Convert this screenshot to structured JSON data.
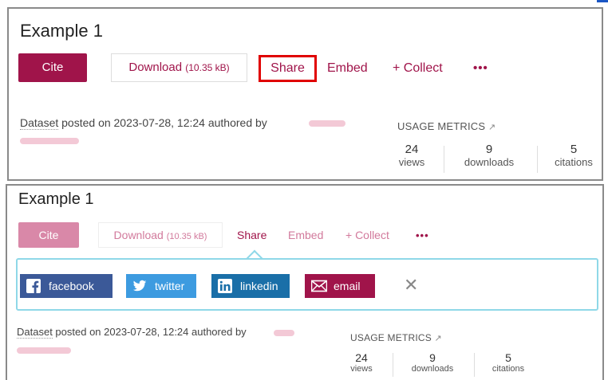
{
  "example1": {
    "title": "Example 1",
    "cite_label": "Cite",
    "download_label": "Download",
    "download_size": "(10.35 kB)",
    "share_label": "Share",
    "embed_label": "Embed",
    "collect_label": "+ Collect",
    "more_label": "•••",
    "posted_prefix": "Dataset",
    "posted_text": " posted on 2023-07-28, 12:24 authored by",
    "usage_label": "USAGE METRICS",
    "metrics": [
      {
        "value": "24",
        "label": "views"
      },
      {
        "value": "9",
        "label": "downloads"
      },
      {
        "value": "5",
        "label": "citations"
      }
    ]
  },
  "example2": {
    "title": "Example 1",
    "cite_label": "Cite",
    "download_label": "Download",
    "download_size": "(10.35 kB)",
    "share_label": "Share",
    "embed_label": "Embed",
    "collect_label": "+ Collect",
    "more_label": "•••",
    "share_buttons": [
      {
        "label": "facebook"
      },
      {
        "label": "twitter"
      },
      {
        "label": "linkedin"
      },
      {
        "label": "email"
      }
    ],
    "close_label": "✕",
    "posted_prefix": "Dataset",
    "posted_text": " posted on 2023-07-28, 12:24 authored by",
    "usage_label": "USAGE METRICS",
    "metrics": [
      {
        "value": "24",
        "label": "views"
      },
      {
        "value": "9",
        "label": "downloads"
      },
      {
        "value": "5",
        "label": "citations"
      }
    ]
  },
  "colors": {
    "brand": "#a0144a",
    "highlight": "#e00000",
    "facebook": "#3b5998",
    "twitter": "#3d9be0",
    "linkedin": "#1a6fa8",
    "share_panel_border": "#8fd8e8"
  }
}
